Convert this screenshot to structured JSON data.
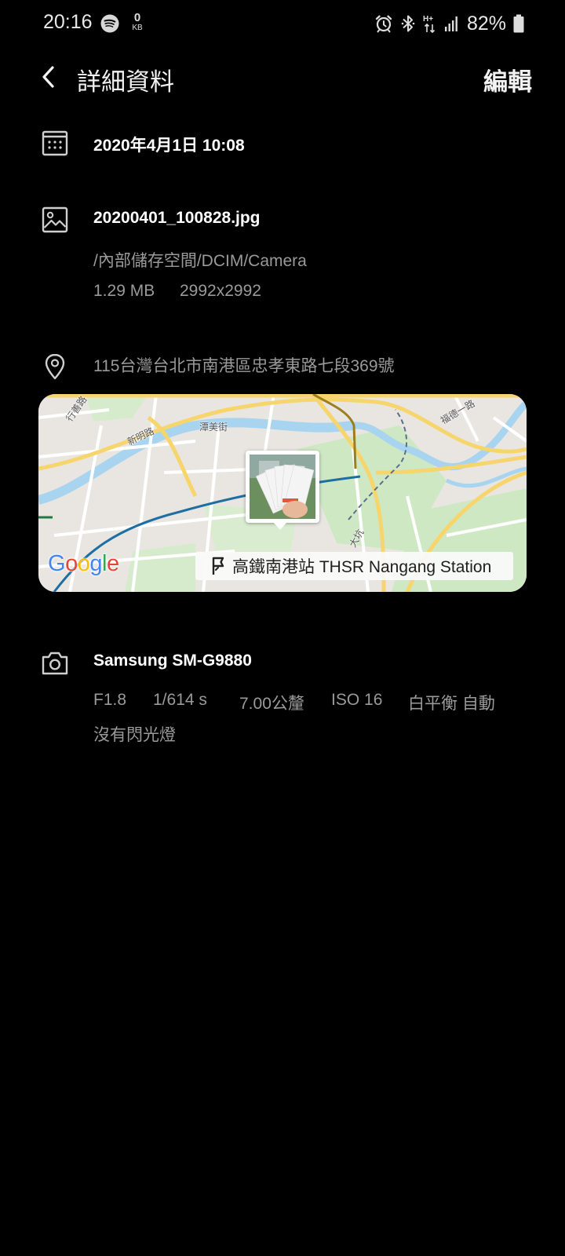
{
  "status_bar": {
    "time": "20:16",
    "data_counter_value": "0",
    "data_counter_unit": "KB",
    "network_type": "H+",
    "battery_percent": "82%",
    "icons": [
      "spotify-icon",
      "alarm-icon",
      "bluetooth-icon",
      "signal-icon",
      "battery-icon"
    ]
  },
  "header": {
    "title": "詳細資料",
    "edit_label": "編輯"
  },
  "date_row": {
    "datetime": "2020年4月1日 10:08"
  },
  "file_row": {
    "filename": "20200401_100828.jpg",
    "path": "/內部儲存空間/DCIM/Camera",
    "size": "1.29 MB",
    "resolution": "2992x2992"
  },
  "location_row": {
    "address": "115台灣台北市南港區忠孝東路七段369號",
    "map": {
      "poi_label": "高鐵南港站 THSR Nangang Station",
      "google_logo": "Google",
      "street_labels": [
        "行善路",
        "潭美街",
        "新明路",
        "福德一路",
        "大坑"
      ]
    }
  },
  "camera_row": {
    "model": "Samsung SM-G9880",
    "aperture": "F1.8",
    "shutter": "1/614 s",
    "focal_length": "7.00公釐",
    "iso": "ISO 16",
    "white_balance": "白平衡 自動",
    "flash": "沒有閃光燈"
  },
  "colors": {
    "background": "#000000",
    "primary_text": "#ffffff",
    "secondary_text": "#9a9a9a",
    "icon": "#cfcfcf"
  }
}
